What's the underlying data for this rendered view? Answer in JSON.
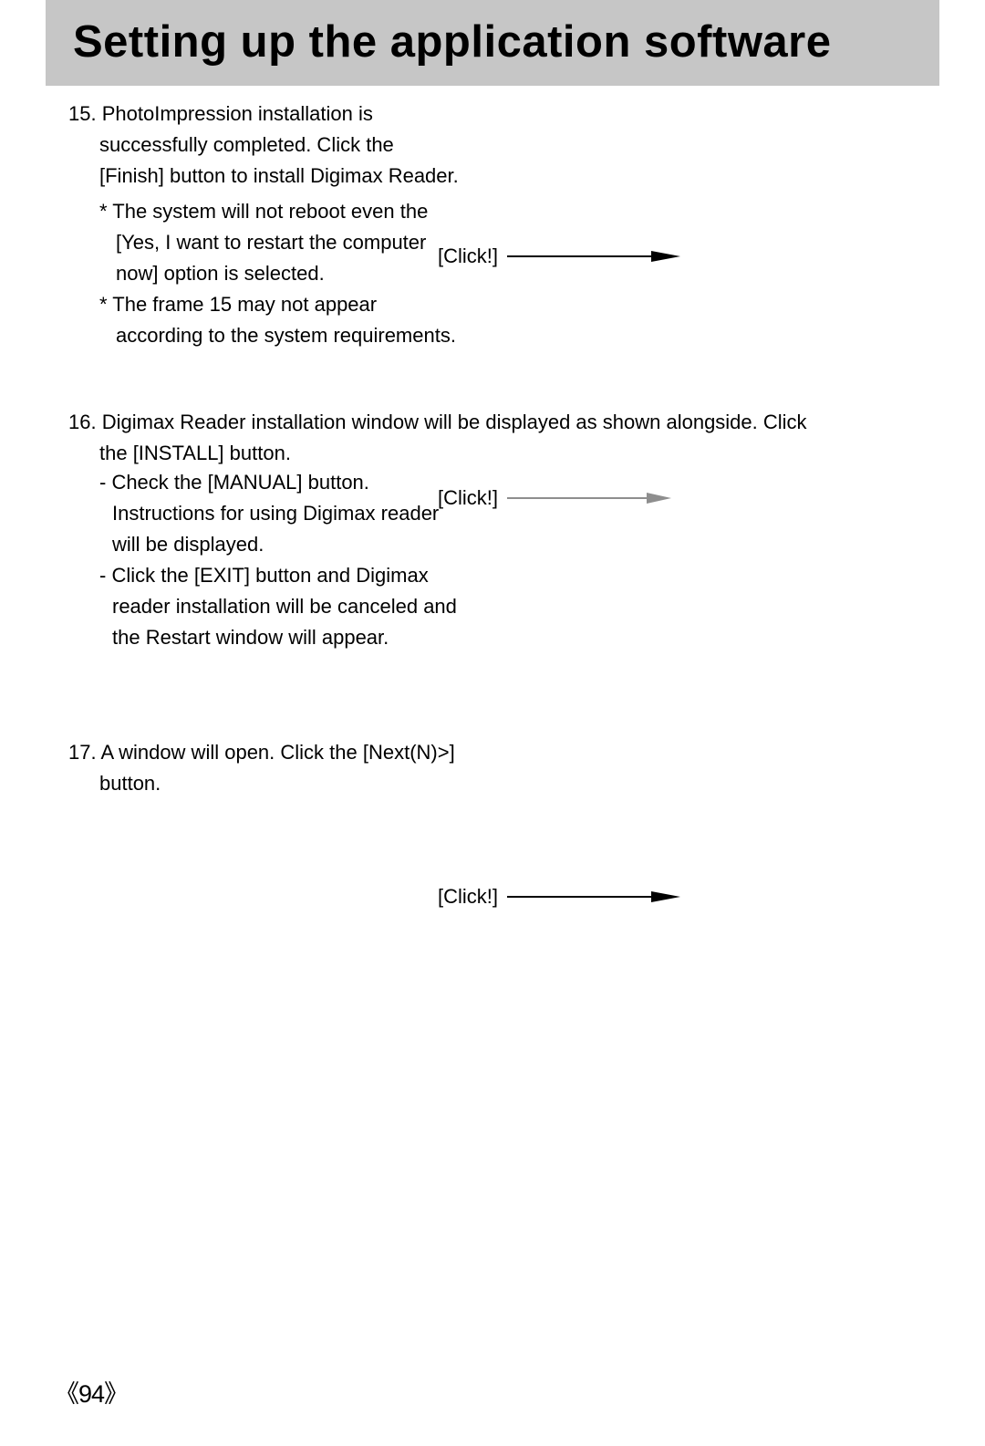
{
  "title": "Setting up the application software",
  "steps": {
    "s15": {
      "num": "15.",
      "text": "PhotoImpression installation is successfully completed. Click the [Finish] button to install Digimax Reader.",
      "note1": "* The system will not reboot even the [Yes, I want to restart the computer now] option is selected.",
      "note2": "* The frame 15 may not appear according to the system requirements."
    },
    "s16": {
      "num": "16.",
      "lead": "Digimax Reader installation window will be displayed as shown alongside. Click the [INSTALL] button.",
      "bullet1": "- Check the [MANUAL] button. Instructions for using Digimax reader will be displayed.",
      "bullet2": "- Click the [EXIT] button and Digimax reader installation will be canceled and the Restart window will appear."
    },
    "s17": {
      "num": "17.",
      "text": "A window will open. Click the [Next(N)>] button."
    }
  },
  "callouts": {
    "c1": {
      "label": "[Click!]",
      "arrow_color": "#000000"
    },
    "c2": {
      "label": "[Click!]",
      "arrow_color": "#8e8e8e"
    },
    "c3": {
      "label": "[Click!]",
      "arrow_color": "#000000"
    }
  },
  "page_number": "94",
  "page_number_left": "《",
  "page_number_right": "》"
}
